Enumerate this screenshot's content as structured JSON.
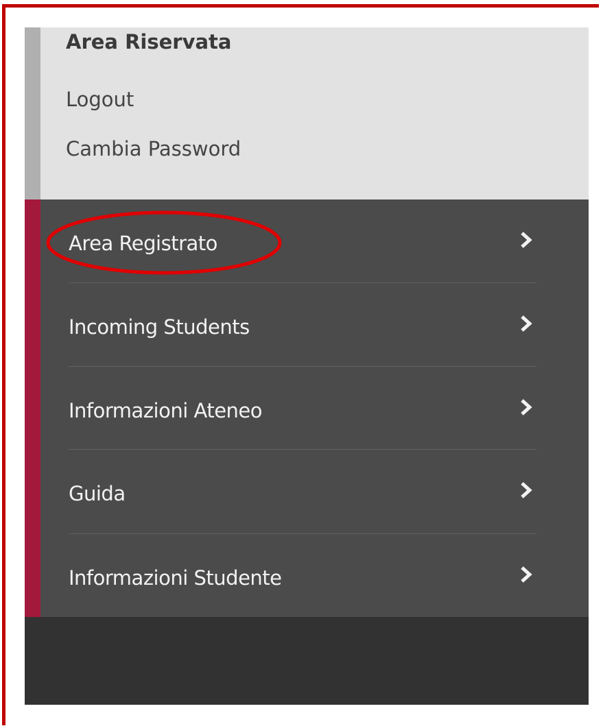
{
  "reserved_area": {
    "title": "Area Riservata",
    "links": [
      "Logout",
      "Cambia Password"
    ]
  },
  "menu": {
    "items": [
      {
        "label": "Area Registrato",
        "icon": "chevron-right-icon"
      },
      {
        "label": "Incoming Students",
        "icon": "chevron-right-icon"
      },
      {
        "label": "Informazioni Ateneo",
        "icon": "chevron-right-icon"
      },
      {
        "label": "Guida",
        "icon": "chevron-right-icon"
      },
      {
        "label": "Informazioni Studente",
        "icon": "chevron-right-icon"
      }
    ]
  },
  "annotation": {
    "highlighted_item": "Area Registrato",
    "color": "#e00000"
  },
  "colors": {
    "frame_border": "#c00000",
    "reserved_bg": "#e2e2e2",
    "menu_bg": "#4b4b4b",
    "menu_accent": "#a3193b",
    "footer_bg": "#323232"
  }
}
